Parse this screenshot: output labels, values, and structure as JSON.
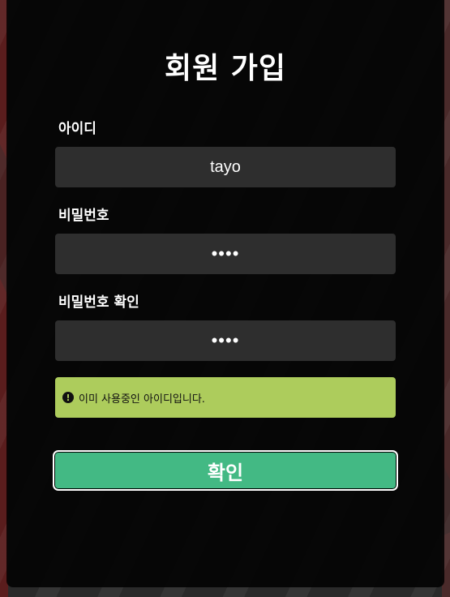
{
  "form": {
    "title": "회원 가입",
    "id_label": "아이디",
    "id_value": "tayo",
    "password_label": "비밀번호",
    "password_value": "••••",
    "confirm_label": "비밀번호 확인",
    "confirm_value": "••••",
    "error_message": "이미 사용중인 아이디입니다.",
    "submit_label": "확인"
  },
  "colors": {
    "card_bg": "#000000",
    "field_bg": "#2e2e2e",
    "alert_bg": "#adcc5c",
    "submit_bg": "#43b984"
  },
  "icons": {
    "alert": "exclamation-circle-icon"
  }
}
